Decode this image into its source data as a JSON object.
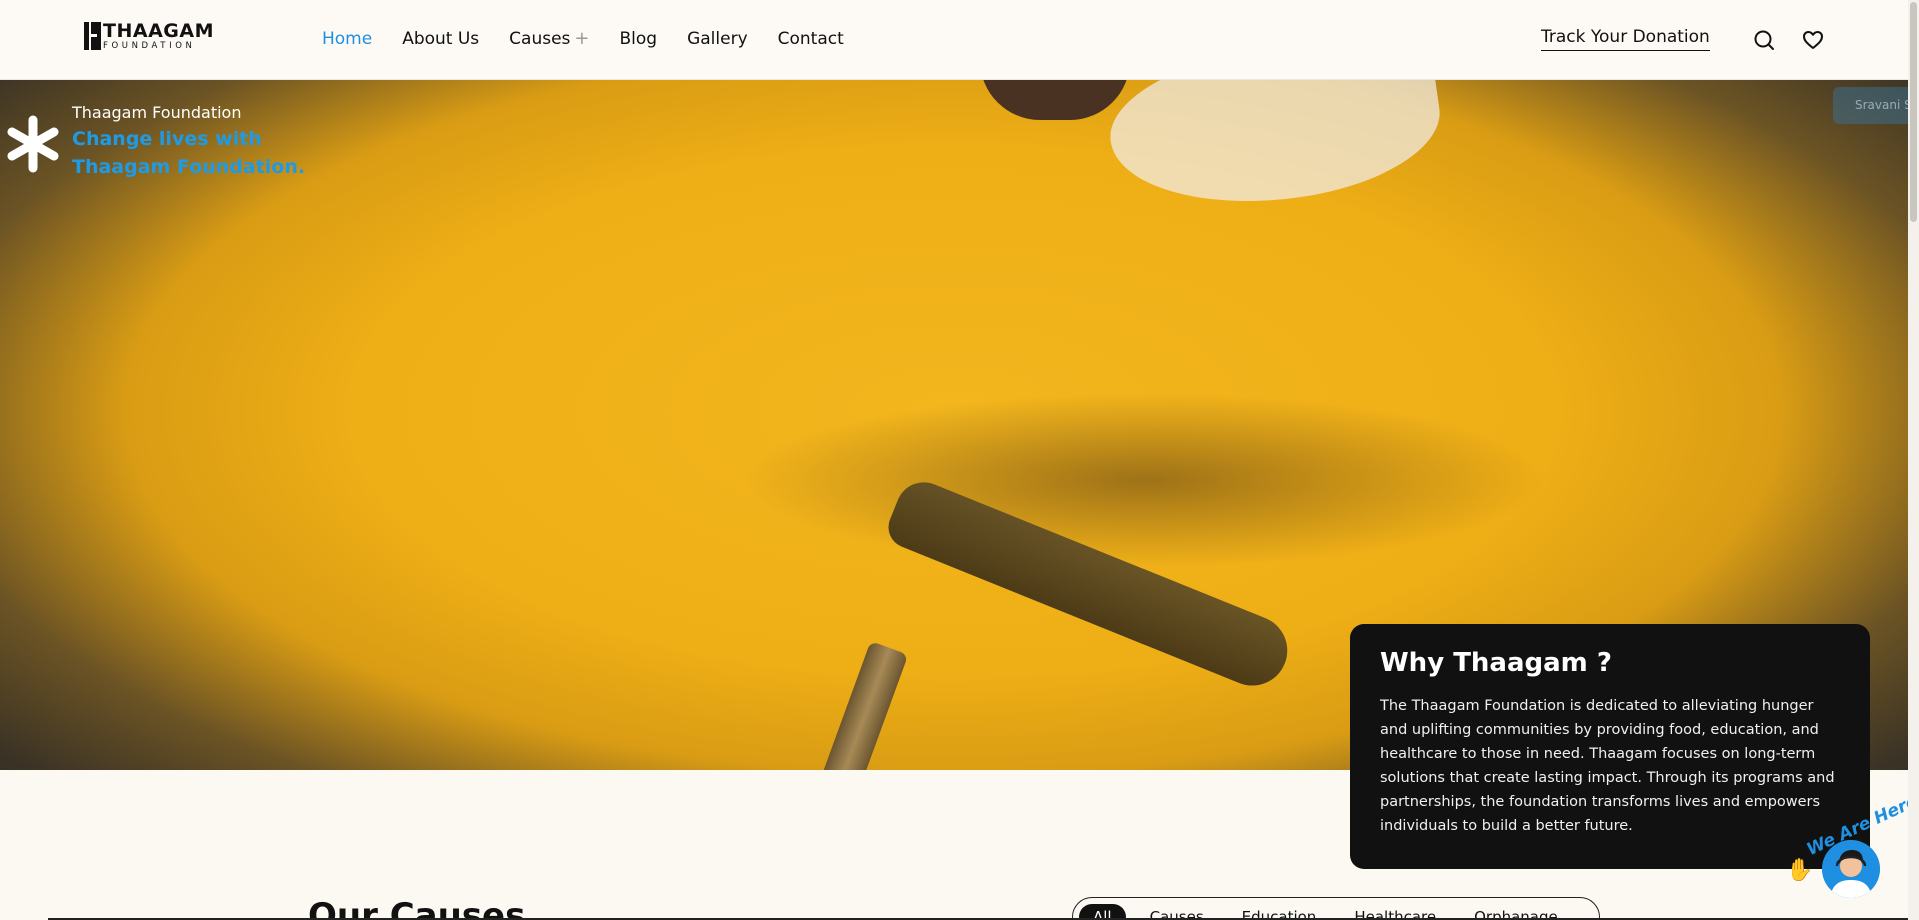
{
  "header": {
    "logo_main": "THAAGAM",
    "logo_sub": "FOUNDATION",
    "nav": [
      {
        "label": "Home",
        "active": true
      },
      {
        "label": "About Us"
      },
      {
        "label": "Causes",
        "has_submenu": true
      },
      {
        "label": "Blog"
      },
      {
        "label": "Gallery"
      },
      {
        "label": "Contact"
      }
    ],
    "causes_plus": "+",
    "track_label": "Track Your Donation",
    "search_icon": "search-icon",
    "favorite_icon": "heart-icon"
  },
  "hero": {
    "org_name": "Thaagam Foundation",
    "tagline": "Change lives with Thaagam Foundation.",
    "right_pill": "Sravani S"
  },
  "why": {
    "title": "Why Thaagam ?",
    "text": "The Thaagam Foundation is dedicated to alleviating hunger and uplifting communities by providing food, education, and healthcare to those in need. Thaagam focuses on long-term solutions that create lasting impact. Through its programs and partnerships, the foundation transforms lives and empowers individuals to build a better future."
  },
  "causes": {
    "title": "Our Causes",
    "filters": [
      "All",
      "Causes",
      "Education",
      "Healthcare",
      "Orphanage"
    ]
  },
  "chat": {
    "label": "We Are Here!",
    "avatar_icon": "support-avatar-icon"
  },
  "colors": {
    "accent": "#1e8fe1",
    "background": "#fcf9f3",
    "card": "#111111"
  }
}
